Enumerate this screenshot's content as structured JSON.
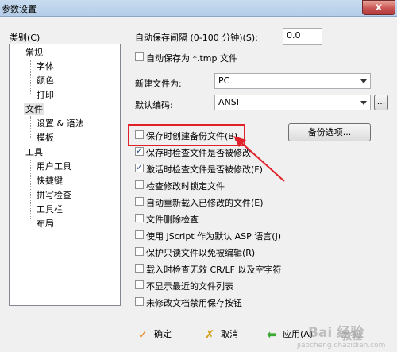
{
  "window": {
    "title": "参数设置",
    "close_glyph": "x"
  },
  "sidebar": {
    "label": "类别(C)",
    "items": [
      "常规",
      "字体",
      "颜色",
      "打印",
      "文件",
      "设置 & 语法",
      "模板",
      "工具",
      "用户工具",
      "快捷键",
      "拼写检查",
      "工具栏",
      "布局"
    ],
    "selected": "文件"
  },
  "autosave": {
    "label": "自动保存间隔 (0-100 分钟)(S):",
    "value": "0.0"
  },
  "tmp_option": {
    "label": "自动保存为 *.tmp 文件",
    "checked": false
  },
  "new_file": {
    "label": "新建文件为:",
    "value": "PC"
  },
  "encoding": {
    "label": "默认编码:",
    "value": "ANSI",
    "more_label": "..."
  },
  "backup_button": "备份选项...",
  "options": [
    {
      "label": "保存时创建备份文件(B)",
      "checked": false
    },
    {
      "label": "保存时检查文件是否被修改",
      "checked": true
    },
    {
      "label": "激活时检查文件是否被修改(F)",
      "checked": true
    },
    {
      "label": "检查修改时锁定文件",
      "checked": false
    },
    {
      "label": "自动重新载入已修改的文件(E)",
      "checked": false
    },
    {
      "label": "文件删除检查",
      "checked": false
    },
    {
      "label": "使用 JScript 作为默认 ASP 语言(J)",
      "checked": false
    },
    {
      "label": "保护只读文件以免被编辑(R)",
      "checked": false
    },
    {
      "label": "载入时检查无效 CR/LF 以及空字符",
      "checked": false
    },
    {
      "label": "不显示最近的文件列表",
      "checked": false
    },
    {
      "label": "未修改文档禁用保存按钮",
      "checked": false
    }
  ],
  "footer": {
    "ok": "确定",
    "cancel": "取消",
    "apply": "应用(A)"
  },
  "watermark": {
    "brand": "Bai 经验",
    "site": "jiaocheng.chazidian.com",
    "tag": "教程"
  },
  "colors": {
    "highlight": "#e0202a",
    "ok_icon": "#e0892a",
    "cancel_icon": "#d4a017",
    "apply_icon": "#3aa832"
  },
  "icons": {
    "ok": "check-icon",
    "cancel": "cross-icon",
    "apply": "arrow-left-icon"
  }
}
